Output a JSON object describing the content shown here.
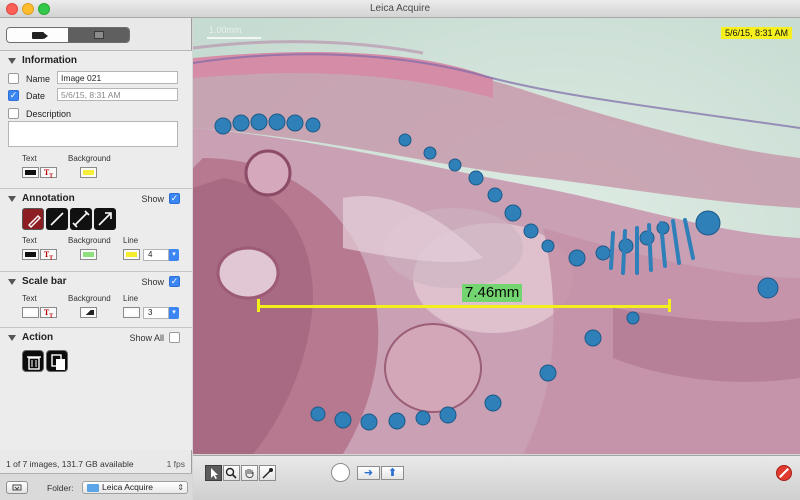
{
  "window": {
    "title": "Leica Acquire"
  },
  "mode_tabs": [
    {
      "icon": "video-camera-icon",
      "selected": true
    },
    {
      "icon": "frame-icon",
      "selected": false
    }
  ],
  "information": {
    "title": "Information",
    "name_label": "Name",
    "name_value": "Image 021",
    "name_checked": false,
    "date_label": "Date",
    "date_value": "5/6/15, 8:31 AM",
    "date_checked": true,
    "description_label": "Description",
    "description_checked": false,
    "description_value": "",
    "text_label": "Text",
    "background_label": "Background"
  },
  "annotation": {
    "title": "Annotation",
    "show_label": "Show",
    "show_checked": true,
    "tools": [
      "pen-icon",
      "line-icon",
      "bar-ends-icon",
      "arrow-icon"
    ],
    "selected_tool": "pen-icon",
    "text_label": "Text",
    "background_label": "Background",
    "line_label": "Line",
    "line_width": "4",
    "background_color": "#8ee07e",
    "line_color": "#f4ec2c"
  },
  "scale_bar": {
    "title": "Scale bar",
    "show_label": "Show",
    "show_checked": true,
    "text_label": "Text",
    "background_label": "Background",
    "line_label": "Line",
    "line_width": "3"
  },
  "action": {
    "title": "Action",
    "show_all_label": "Show All",
    "show_all_checked": false,
    "buttons": [
      "trash-icon",
      "copy-icon"
    ]
  },
  "status": {
    "images_text": "1 of 7 images, 131.7 GB available",
    "fps_text": "1 fps"
  },
  "folder": {
    "label": "Folder:",
    "value": "Leica Acquire"
  },
  "viewport": {
    "scale_text": "1.00mm",
    "timestamp": "5/6/15, 8:31 AM",
    "measurement": "7.46mm",
    "timestamp_bg": "#f5ef1e",
    "measurement_bg": "#73d56f",
    "measurement_line_color": "#f2ef1a"
  },
  "bottom_toolbar": {
    "tools": [
      "pointer-icon",
      "magnifier-icon",
      "hand-icon",
      "eyedropper-icon"
    ],
    "selected_tool": "pointer-icon",
    "nav": [
      "right-arrow-icon",
      "up-arrow-icon"
    ]
  },
  "accent": "#3b86f2"
}
